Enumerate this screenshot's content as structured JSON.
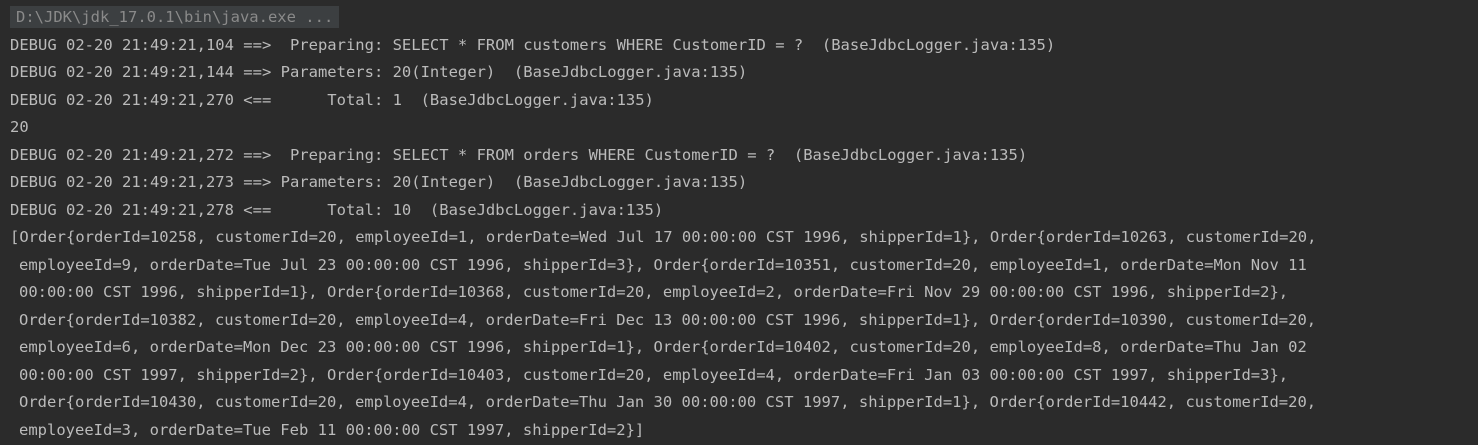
{
  "console": {
    "command": "D:\\JDK\\jdk_17.0.1\\bin\\java.exe ...",
    "lines": [
      "DEBUG 02-20 21:49:21,104 ==>  Preparing: SELECT * FROM customers WHERE CustomerID = ?  (BaseJdbcLogger.java:135)",
      "DEBUG 02-20 21:49:21,144 ==> Parameters: 20(Integer)  (BaseJdbcLogger.java:135)",
      "DEBUG 02-20 21:49:21,270 <==      Total: 1  (BaseJdbcLogger.java:135)",
      "20",
      "DEBUG 02-20 21:49:21,272 ==>  Preparing: SELECT * FROM orders WHERE CustomerID = ?  (BaseJdbcLogger.java:135)",
      "DEBUG 02-20 21:49:21,273 ==> Parameters: 20(Integer)  (BaseJdbcLogger.java:135)",
      "DEBUG 02-20 21:49:21,278 <==      Total: 10  (BaseJdbcLogger.java:135)",
      "[Order{orderId=10258, customerId=20, employeeId=1, orderDate=Wed Jul 17 00:00:00 CST 1996, shipperId=1}, Order{orderId=10263, customerId=20,",
      "employeeId=9, orderDate=Tue Jul 23 00:00:00 CST 1996, shipperId=3}, Order{orderId=10351, customerId=20, employeeId=1, orderDate=Mon Nov 11",
      "00:00:00 CST 1996, shipperId=1}, Order{orderId=10368, customerId=20, employeeId=2, orderDate=Fri Nov 29 00:00:00 CST 1996, shipperId=2},",
      "Order{orderId=10382, customerId=20, employeeId=4, orderDate=Fri Dec 13 00:00:00 CST 1996, shipperId=1}, Order{orderId=10390, customerId=20,",
      "employeeId=6, orderDate=Mon Dec 23 00:00:00 CST 1996, shipperId=1}, Order{orderId=10402, customerId=20, employeeId=8, orderDate=Thu Jan 02",
      "00:00:00 CST 1997, shipperId=2}, Order{orderId=10403, customerId=20, employeeId=4, orderDate=Fri Jan 03 00:00:00 CST 1997, shipperId=3},",
      "Order{orderId=10430, customerId=20, employeeId=4, orderDate=Thu Jan 30 00:00:00 CST 1997, shipperId=1}, Order{orderId=10442, customerId=20,",
      "employeeId=3, orderDate=Tue Feb 11 00:00:00 CST 1997, shipperId=2}]"
    ]
  }
}
